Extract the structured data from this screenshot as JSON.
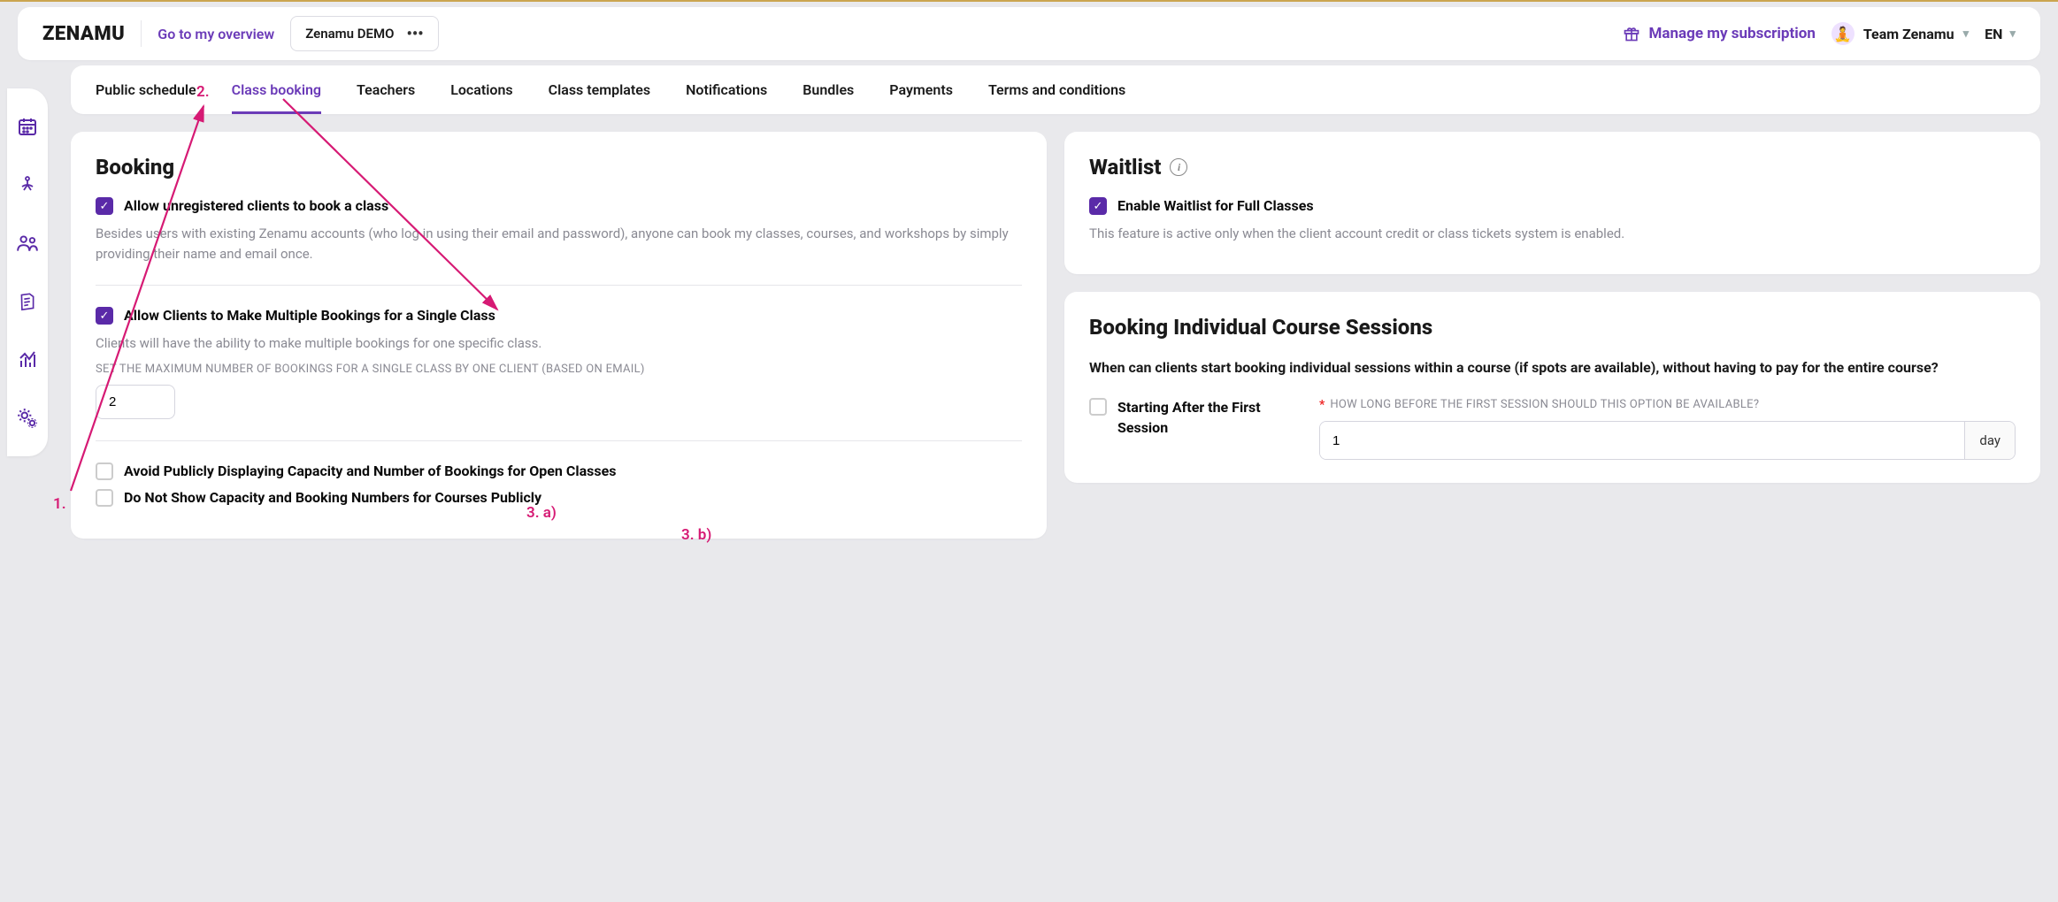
{
  "header": {
    "logo_text": "ZENAMU",
    "overview_link": "Go to my overview",
    "org_name": "Zenamu DEMO",
    "manage_subscription": "Manage my subscription",
    "team_name": "Team Zenamu",
    "language": "EN"
  },
  "tabs": [
    {
      "label": "Public schedule"
    },
    {
      "label": "Class booking"
    },
    {
      "label": "Teachers"
    },
    {
      "label": "Locations"
    },
    {
      "label": "Class templates"
    },
    {
      "label": "Notifications"
    },
    {
      "label": "Bundles"
    },
    {
      "label": "Payments"
    },
    {
      "label": "Terms and conditions"
    }
  ],
  "booking": {
    "title": "Booking",
    "allow_unregistered": {
      "label": "Allow unregistered clients to book a class",
      "help": "Besides users with existing Zenamu accounts (who log in using their email and password), anyone can book my classes, courses, and workshops by simply providing their name and email once."
    },
    "allow_multiple": {
      "label": "Allow Clients to Make Multiple Bookings for a Single Class",
      "help": "Clients will have the ability to make multiple bookings for one specific class.",
      "max_label": "SET THE MAXIMUM NUMBER OF BOOKINGS FOR A SINGLE CLASS BY ONE CLIENT (BASED ON EMAIL)",
      "max_value": "2"
    },
    "avoid_capacity_open": "Avoid Publicly Displaying Capacity and Number of Bookings for Open Classes",
    "avoid_capacity_courses": "Do Not Show Capacity and Booking Numbers for Courses Publicly"
  },
  "waitlist": {
    "title": "Waitlist",
    "enable_label": "Enable Waitlist for Full Classes",
    "help": "This feature is active only when the client account credit or class tickets system is enabled."
  },
  "individual": {
    "title": "Booking Individual Course Sessions",
    "question": "When can clients start booking individual sessions within a course (if spots are available), without having to pay for the entire course?",
    "start_after_label": "Starting After the First Session",
    "how_long_label": "HOW LONG BEFORE THE FIRST SESSION SHOULD THIS OPTION BE AVAILABLE?",
    "how_long_value": "1",
    "how_long_unit": "day"
  },
  "annotations": {
    "a1": "1.",
    "a2": "2.",
    "a3a": "3. a)",
    "a3b": "3. b)"
  }
}
